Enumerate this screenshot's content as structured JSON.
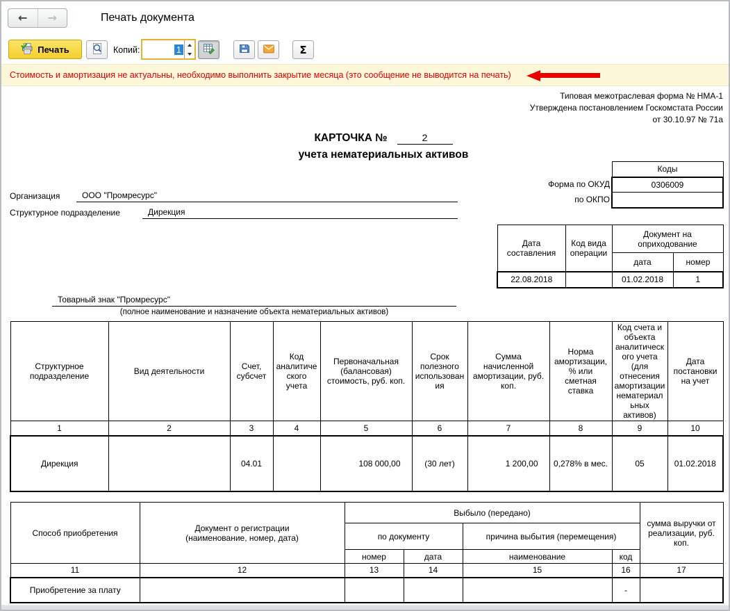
{
  "window": {
    "title": "Печать документа"
  },
  "toolbar": {
    "back_icon": "←",
    "forward_icon": "→",
    "print_label": "Печать",
    "copies_label": "Копий:",
    "copies_value": "1",
    "sigma_label": "Σ"
  },
  "warning": {
    "text": "Стоимость и амортизация не актуальны, необходимо выполнить закрытие месяца (это сообщение не выводится на печать)"
  },
  "colors": {
    "print_button_yellow": "#f5d02c",
    "warning_bg": "#fcf7d9",
    "warning_text": "#e50000",
    "arrow_red": "#e80000",
    "selection_blue": "#2e86d8"
  },
  "form": {
    "approval_line1": "Типовая межотраслевая форма № НМА-1",
    "approval_line2": "Утверждена постановлением Госкомстата России",
    "approval_line3": "от 30.10.97 № 71а",
    "card_title": "КАРТОЧКА №",
    "card_number": "2",
    "card_subtitle": "учета нематериальных активов",
    "codes": {
      "header": "Коды",
      "okud_label": "Форма по ОКУД",
      "okud_value": "0306009",
      "okpo_label": "по ОКПО",
      "okpo_value": ""
    },
    "org_label": "Организация",
    "org_value": "ООО \"Промресурс\"",
    "dept_label": "Структурное подразделение",
    "dept_value": "Дирекция",
    "dates_table": {
      "date_col": "Дата составления",
      "opcode_col": "Код вида операции",
      "doc_col": "Документ на оприходование",
      "doc_date_col": "дата",
      "doc_num_col": "номер",
      "row": {
        "date": "22.08.2018",
        "opcode": "",
        "doc_date": "01.02.2018",
        "doc_num": "1"
      }
    },
    "object_name": "Товарный знак \"Промресурс\"",
    "object_caption": "(полное наименование и назначение объекта нематериальных активов)",
    "main_table": {
      "headers": [
        "Структурное подразделение",
        "Вид деятельности",
        "Счет, субсчет",
        "Код аналитического учета",
        "Первоначальная (балансовая) стоимость, руб. коп.",
        "Срок полезного использования",
        "Сумма начисленной амортизации, руб. коп.",
        "Норма амортизации, % или сметная ставка",
        "Код счета и объекта аналитического учета (для отнесения амортизации нематериальных активов)",
        "Дата постановки на учет"
      ],
      "numbers": [
        "1",
        "2",
        "3",
        "4",
        "5",
        "6",
        "7",
        "8",
        "9",
        "10"
      ],
      "row": [
        "Дирекция",
        "",
        "04.01",
        "",
        "108 000,00",
        "(30 лет)",
        "1 200,00",
        "0,278% в мес.",
        "05",
        "01.02.2018"
      ]
    },
    "disposal_table": {
      "acq_col": "Способ приобретения",
      "reg_col_line1": "Документ о регистрации",
      "reg_col_line2": "(наименование, номер, дата)",
      "disposed_col": "Выбыло (передано)",
      "bydoc_col": "по документу",
      "reason_col": "причина выбытия (перемещения)",
      "revenue_col": "сумма выручки от реализации, руб. коп.",
      "sub_num": "номер",
      "sub_date": "дата",
      "sub_name": "наименование",
      "sub_code": "код",
      "numbers": [
        "11",
        "12",
        "13",
        "14",
        "15",
        "16",
        "17"
      ],
      "row": [
        "Приобретение за плату",
        "",
        "",
        "",
        "",
        "-",
        ""
      ]
    }
  }
}
